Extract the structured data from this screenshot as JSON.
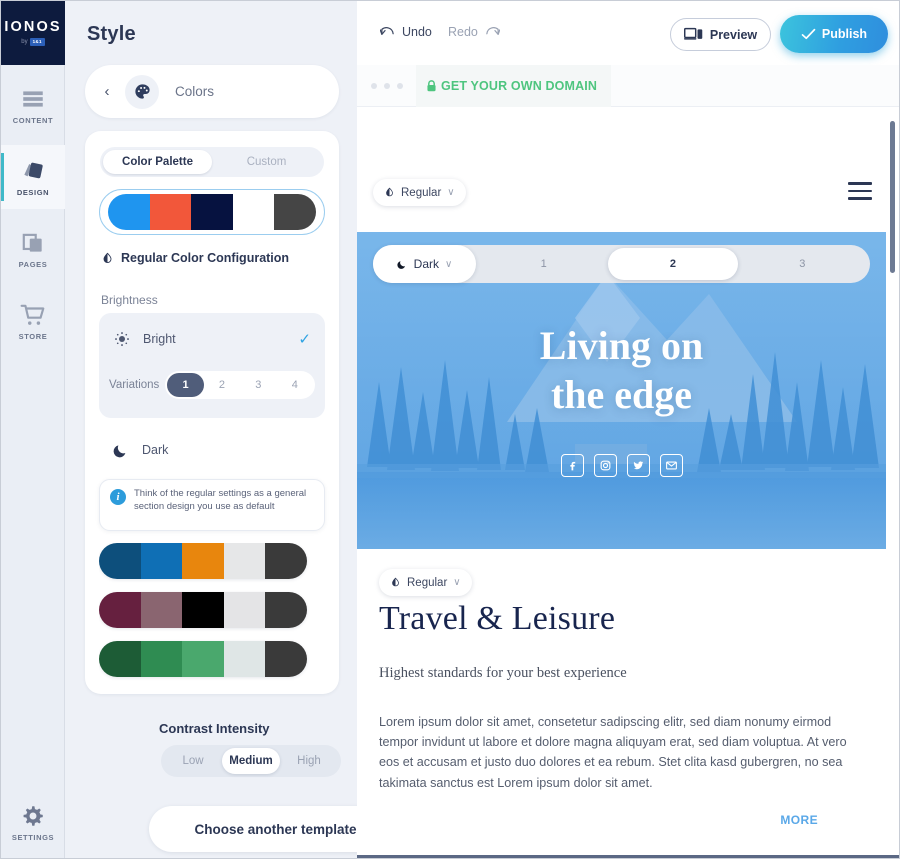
{
  "brand": {
    "logo_word": "IONOS",
    "logo_badge": "1&1",
    "logo_tick": "by"
  },
  "rail": {
    "items": [
      {
        "label": "CONTENT",
        "icon": "content-lines-icon",
        "active": false
      },
      {
        "label": "DESIGN",
        "icon": "design-swatch-icon",
        "active": true
      },
      {
        "label": "PAGES",
        "icon": "pages-icon",
        "active": false
      },
      {
        "label": "STORE",
        "icon": "cart-icon",
        "active": false
      }
    ],
    "settings": {
      "label": "SETTINGS",
      "icon": "gear-icon"
    }
  },
  "panel": {
    "title": "Style",
    "header": {
      "back": "‹",
      "icon": "palette-icon",
      "label": "Colors"
    },
    "tabs": [
      {
        "label": "Color Palette",
        "selected": true
      },
      {
        "label": "Custom",
        "selected": false
      }
    ],
    "active_palette": {
      "colors": [
        "#1f95ef",
        "#f2573a",
        "#061240",
        "#ffffff",
        "#454545"
      ]
    },
    "regular_config_label": "Regular Color Configuration",
    "brightness_label": "Brightness",
    "bright": {
      "label": "Bright",
      "icon": "sun-icon",
      "checked": true,
      "check_glyph": "✓"
    },
    "variations": {
      "label": "Variations",
      "options": [
        "1",
        "2",
        "3",
        "4"
      ],
      "selected": "1"
    },
    "dark": {
      "label": "Dark",
      "icon": "moon-icon"
    },
    "tip": {
      "icon": "info-icon",
      "text": "Think of the regular settings as a general section design you use as default"
    },
    "palette_list": [
      {
        "colors": [
          "#0d4f7c",
          "#0f6fb5",
          "#e8860d",
          "#e6e7e8",
          "#3a3a3a"
        ]
      },
      {
        "colors": [
          "#66203f",
          "#8a6570",
          "#000000",
          "#e4e4e6",
          "#3a3a3a"
        ]
      },
      {
        "colors": [
          "#1d5c36",
          "#2f8c52",
          "#4aa86d",
          "#dfe6e6",
          "#3a3a3a"
        ]
      }
    ],
    "contrast": {
      "label": "Contrast Intensity",
      "options": [
        "Low",
        "Medium",
        "High"
      ],
      "selected": "Medium"
    },
    "choose_template_label": "Choose another template"
  },
  "toolbar": {
    "undo": {
      "label": "Undo",
      "icon": "undo-arrow-icon"
    },
    "redo": {
      "label": "Redo",
      "icon": "redo-arrow-icon"
    },
    "preview": {
      "label": "Preview",
      "icon": "device-preview-icon"
    },
    "publish": {
      "label": "Publish",
      "icon": "check-icon",
      "accent": "#2f9fe0"
    }
  },
  "preview": {
    "domain_bar": {
      "icon": "lock-icon",
      "text": "GET YOUR OWN DOMAIN",
      "color": "#4ec57f"
    },
    "nav": {
      "mode_pill": {
        "label": "Regular",
        "icon": "contrast-drop-icon",
        "caret": "∨"
      },
      "menu_icon": "hamburger-icon"
    },
    "hero": {
      "mode_pill": {
        "label": "Dark",
        "icon": "moon-icon",
        "caret": "∨"
      },
      "variations": [
        "1",
        "2",
        "3"
      ],
      "selected_variation": "2",
      "title_line1": "Living on",
      "title_line2": "the edge",
      "social": [
        {
          "name": "facebook-icon",
          "glyph": "f"
        },
        {
          "name": "instagram-icon",
          "glyph": "▢"
        },
        {
          "name": "twitter-icon",
          "glyph": "ᵗ"
        },
        {
          "name": "email-icon",
          "glyph": "✉"
        }
      ]
    },
    "section": {
      "mode_pill": {
        "label": "Regular",
        "icon": "contrast-drop-icon",
        "caret": "∨"
      },
      "title": "Travel & Leisure",
      "subtitle": "Highest standards for your best experience",
      "body": "Lorem ipsum dolor sit amet, consetetur sadipscing elitr, sed diam nonumy eirmod tempor invidunt ut labore et dolore magna aliquyam erat, sed diam voluptua. At vero eos et accusam et justo duo dolores et ea rebum. Stet clita kasd gubergren, no sea takimata sanctus est Lorem ipsum dolor sit amet.",
      "more_label": "MORE"
    }
  }
}
